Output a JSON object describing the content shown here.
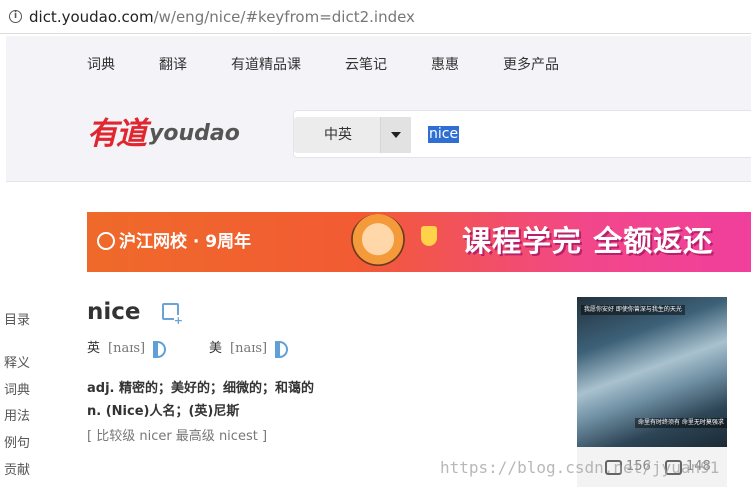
{
  "browser": {
    "url_host": "dict.youdao.com",
    "url_path": "/w/eng/nice/#keyfrom=dict2.index",
    "info_icon": "info-icon"
  },
  "nav": {
    "items": [
      "词典",
      "翻译",
      "有道精品课",
      "云笔记",
      "惠惠",
      "更多产品"
    ]
  },
  "logo": {
    "cn": "有道",
    "en": "youdao",
    "color": "#e0262e"
  },
  "search": {
    "lang": "中英",
    "query": "nice",
    "dropdown_icon": "caret-down-icon"
  },
  "banner": {
    "school": "沪江网校 · 9周年",
    "slogan": "课程学完 全额返还"
  },
  "sidebar": {
    "items": [
      "目录",
      "释义",
      "词典",
      "用法",
      "例句",
      "贡献"
    ]
  },
  "entry": {
    "word": "nice",
    "wordbook_icon": "add-to-wordbook-icon",
    "uk": {
      "label": "英",
      "ipa": "[naɪs]"
    },
    "us": {
      "label": "美",
      "ipa": "[naɪs]"
    },
    "definitions": [
      "adj. 精密的；美好的；细微的；和蔼的",
      "n. (Nice)人名；(英)尼斯"
    ],
    "forms": "[ 比较级 nicer 最高级 nicest ]"
  },
  "image_card": {
    "caption_top": "我愿你安好 即使你曾深与我生的天光",
    "caption_bottom": "命里有时终须有 命里无时莫强求",
    "likes": "156",
    "dislikes": "148"
  },
  "watermark": "https://blog.csdn.net/jyuan91"
}
